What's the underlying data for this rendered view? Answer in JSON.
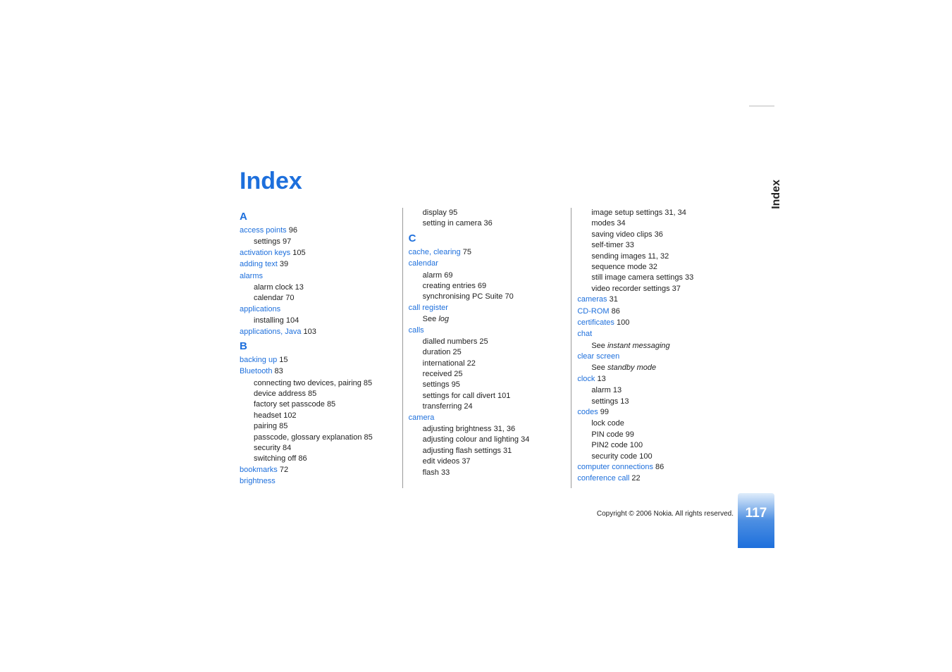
{
  "title": "Index",
  "side_tab": "Index",
  "page_number": "117",
  "copyright": "Copyright © 2006 Nokia. All rights reserved.",
  "col1": {
    "letterA": "A",
    "access_points": "access points",
    "access_points_p": " 96",
    "access_points_settings": "settings 97",
    "activation_keys": "activation keys",
    "activation_keys_p": " 105",
    "adding_text": "adding text",
    "adding_text_p": " 39",
    "alarms": "alarms",
    "alarms_clock": "alarm clock 13",
    "alarms_calendar": "calendar 70",
    "applications": "applications",
    "applications_installing": "installing 104",
    "applications_java": "applications, Java",
    "applications_java_p": " 103",
    "letterB": "B",
    "backing_up": "backing up",
    "backing_up_p": " 15",
    "bluetooth": "Bluetooth",
    "bluetooth_p": " 83",
    "bt_connecting": "connecting two devices, pairing 85",
    "bt_device_addr": "device address 85",
    "bt_factory": "factory set passcode 85",
    "bt_headset": "headset 102",
    "bt_pairing": "pairing 85",
    "bt_passcode": "passcode, glossary explanation 85",
    "bt_security": "security 84",
    "bt_switching": "switching off 86",
    "bookmarks": "bookmarks",
    "bookmarks_p": " 72",
    "brightness": "brightness"
  },
  "col2": {
    "brightness_display": "display 95",
    "brightness_setting_camera": "setting in camera 36",
    "letterC": "C",
    "cache": "cache, clearing",
    "cache_p": " 75",
    "calendar": "calendar",
    "cal_alarm": "alarm 69",
    "cal_creating": "creating entries 69",
    "cal_sync": "synchronising PC Suite 70",
    "call_register": "call register",
    "call_register_see_pre": "See ",
    "call_register_see": "log",
    "calls": "calls",
    "calls_dialled": "dialled numbers 25",
    "calls_duration": "duration 25",
    "calls_international": "international 22",
    "calls_received": "received 25",
    "calls_settings": "settings 95",
    "calls_divert": "settings for call divert 101",
    "calls_transferring": "transferring 24",
    "camera": "camera",
    "cam_brightness": "adjusting brightness 31, 36",
    "cam_colour": "adjusting colour and lighting 34",
    "cam_flash_settings": "adjusting flash settings 31",
    "cam_edit_videos": "edit videos 37",
    "cam_flash": "flash 33"
  },
  "col3": {
    "cam_image_setup": "image setup settings 31, 34",
    "cam_modes": "modes 34",
    "cam_saving": "saving video clips 36",
    "cam_self_timer": "self-timer 33",
    "cam_sending_images": "sending images 11, 32",
    "cam_sequence": "sequence mode 32",
    "cam_still": "still image camera settings 33",
    "cam_video_rec": "video recorder settings 37",
    "cameras": "cameras",
    "cameras_p": " 31",
    "cdrom": "CD-ROM",
    "cdrom_p": " 86",
    "certificates": "certificates",
    "certificates_p": " 100",
    "chat": "chat",
    "chat_see_pre": "See ",
    "chat_see": "instant messaging",
    "clear_screen": "clear screen",
    "clear_screen_see_pre": "See ",
    "clear_screen_see": "standby mode",
    "clock": "clock",
    "clock_p": " 13",
    "clock_alarm": "alarm 13",
    "clock_settings": "settings 13",
    "codes": "codes",
    "codes_p": " 99",
    "codes_lock": "lock code",
    "codes_pin": "PIN code 99",
    "codes_pin2": "PIN2 code 100",
    "codes_security": "security code 100",
    "computer_connections": "computer connections",
    "computer_connections_p": " 86",
    "conference_call": "conference call",
    "conference_call_p": " 22"
  }
}
